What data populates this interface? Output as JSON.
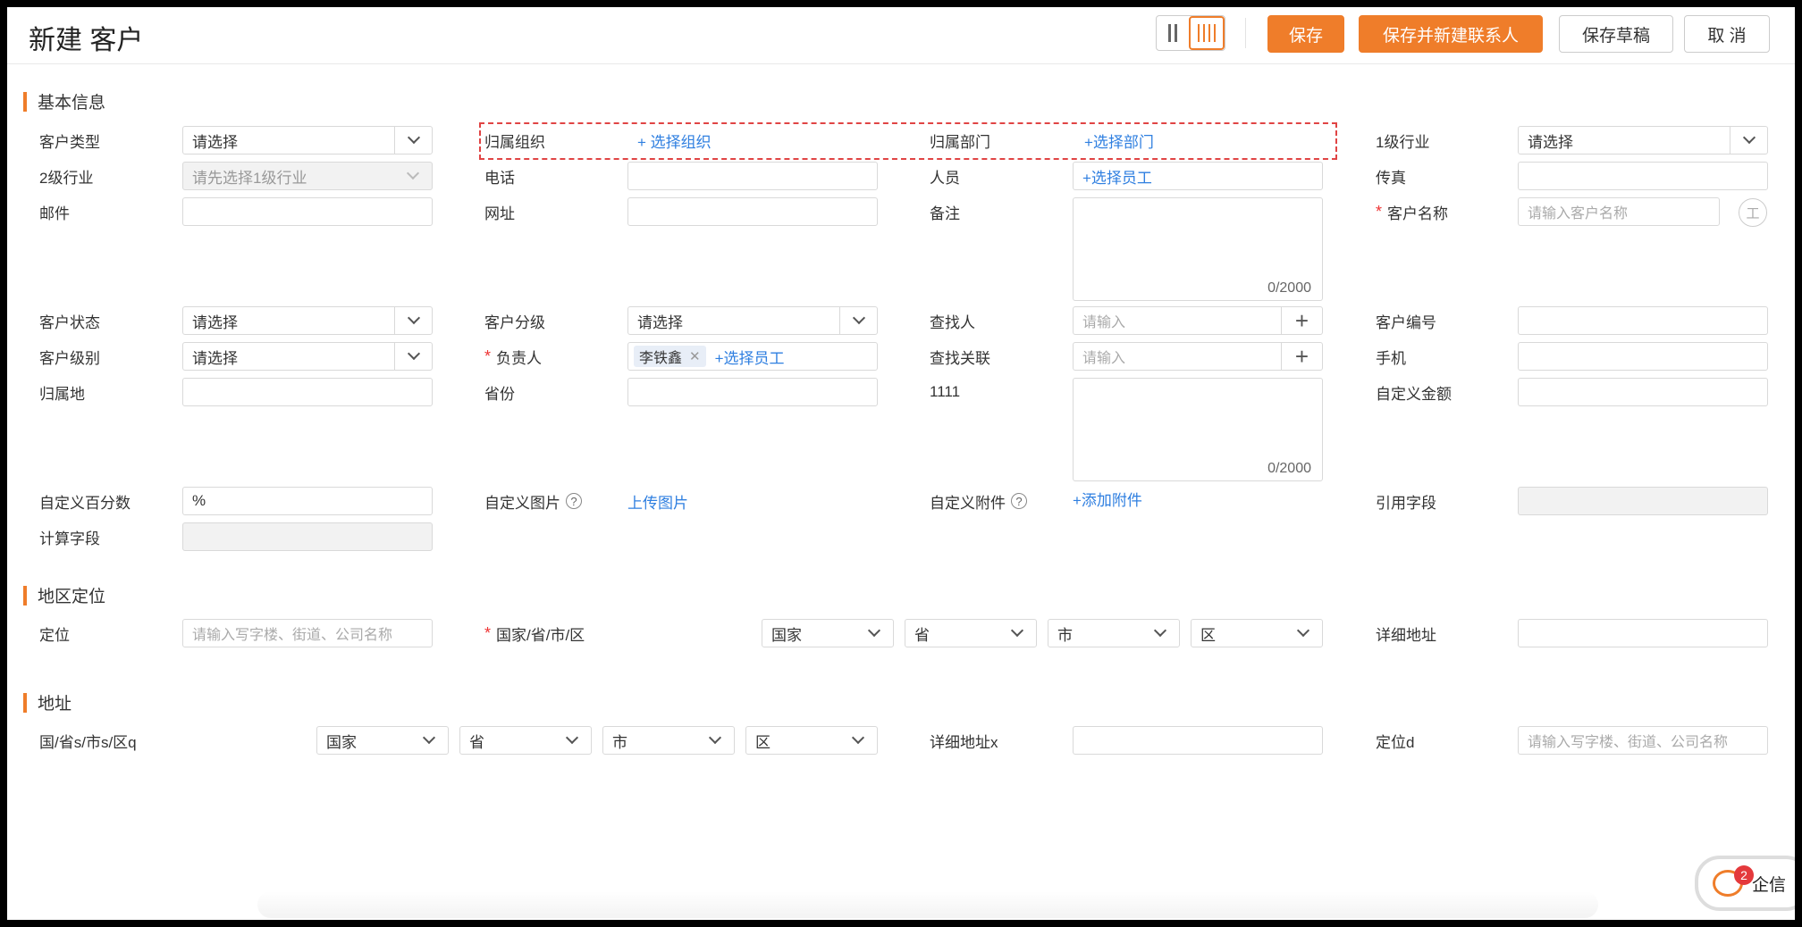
{
  "page": {
    "title": "新建 客户"
  },
  "toolbar": {
    "save": "保存",
    "save_new_contact": "保存并新建联系人",
    "save_draft": "保存草稿",
    "cancel": "取 消"
  },
  "sections": {
    "basic": "基本信息",
    "region": "地区定位",
    "address": "地址"
  },
  "placeholders": {
    "select": "请选择",
    "industry1_first": "请先选择1级行业",
    "customer_name": "请输入客户名称",
    "input": "请输入",
    "location": "请输入写字楼、街道、公司名称"
  },
  "links": {
    "select_org": "+ 选择组织",
    "select_dept": "+选择部门",
    "select_staff": "+选择员工",
    "upload_image": "上传图片",
    "add_attachment": "+添加附件"
  },
  "basic": {
    "customer_type": "客户类型",
    "org": "归属组织",
    "dept": "归属部门",
    "industry1": "1级行业",
    "industry2": "2级行业",
    "phone": "电话",
    "staff": "人员",
    "fax": "传真",
    "email": "邮件",
    "website": "网址",
    "remark": "备注",
    "remark_count": "0/2000",
    "customer_name": "客户名称",
    "customer_status": "客户状态",
    "customer_grade": "客户分级",
    "finder": "查找人",
    "customer_no": "客户编号",
    "customer_level": "客户级别",
    "owner": "负责人",
    "owner_tag": "李铁鑫",
    "finder_link": "查找关联",
    "mobile": "手机",
    "region": "归属地",
    "province": "省份",
    "f1111": "1111",
    "f1111_count": "0/2000",
    "custom_amount": "自定义金额",
    "custom_percent": "自定义百分数",
    "percent_value": "%",
    "custom_image": "自定义图片",
    "custom_attachment": "自定义附件",
    "ref_field": "引用字段",
    "calc_field": "计算字段",
    "help_glyph": "?",
    "icon_glyph": "工"
  },
  "region": {
    "locate": "定位",
    "country_label": "国家/省/市/区",
    "country": "国家",
    "province": "省",
    "city": "市",
    "district": "区",
    "detail": "详细地址"
  },
  "address": {
    "label": "国/省s/市s/区q",
    "country": "国家",
    "province": "省",
    "city": "市",
    "district": "区",
    "detail": "详细地址x",
    "locate": "定位d"
  },
  "chat": {
    "badge": "2",
    "label": "企信"
  },
  "colors": {
    "accent": "#ef7d2a",
    "link": "#2f7fe0",
    "required": "#e33333"
  }
}
